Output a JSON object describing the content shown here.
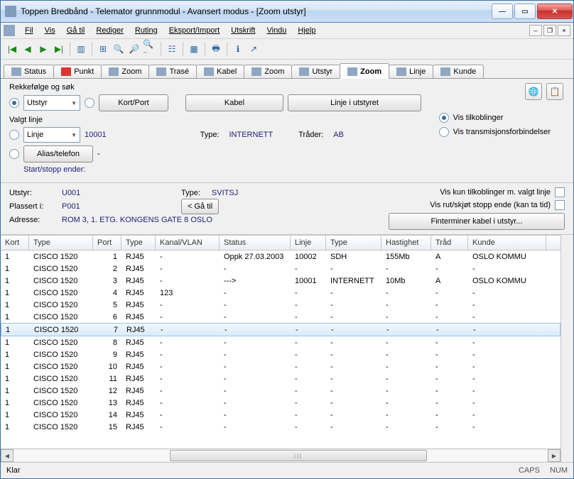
{
  "window": {
    "title": "Toppen Bredbånd - Telemator grunnmodul - Avansert modus - [Zoom utstyr]"
  },
  "menu": {
    "items": [
      "Fil",
      "Vis",
      "Gå til",
      "Rediger",
      "Ruting",
      "Eksport/Import",
      "Utskrift",
      "Vindu",
      "Hjelp"
    ]
  },
  "tabs": [
    {
      "label": "Status"
    },
    {
      "label": "Punkt"
    },
    {
      "label": "Zoom"
    },
    {
      "label": "Trasé"
    },
    {
      "label": "Kabel"
    },
    {
      "label": "Zoom"
    },
    {
      "label": "Utstyr"
    },
    {
      "label": "Zoom",
      "active": true
    },
    {
      "label": "Linje"
    },
    {
      "label": "Kunde"
    }
  ],
  "search": {
    "heading": "Rekkefølge og søk",
    "dropdown1": "Utstyr",
    "opt_kortport": "Kort/Port",
    "btn_kabel": "Kabel",
    "btn_linje": "Linje i utstyret"
  },
  "valgtlinje": {
    "heading": "Valgt linje",
    "dropdown": "Linje",
    "value": "10001",
    "type_label": "Type:",
    "type_value": "INTERNETT",
    "trader_label": "Tråder:",
    "trader_value": "AB",
    "alias_btn": "Alias/telefon",
    "alias_value": "-",
    "startstopp": "Start/stopp ender:"
  },
  "vis_opts": {
    "opt1": "Vis tilkoblinger",
    "opt2": "Vis transmisjonsforbindelser"
  },
  "mid": {
    "utstyr_label": "Utstyr:",
    "utstyr_value": "U001",
    "type_label": "Type:",
    "type_value": "SVITSJ",
    "plassert_label": "Plassert i:",
    "plassert_value": "P001",
    "gaatil": "< Gå til",
    "adresse_label": "Adresse:",
    "adresse_value": "ROM 3, 1. ETG. KONGENS GATE 8 OSLO",
    "chk1": "Vis kun tilkoblinger m. valgt linje",
    "chk2": "Vis rut/skjøt stopp ende (kan ta tid)",
    "btn_fint": "Finterminer kabel i utstyr..."
  },
  "table": {
    "headers": [
      "Kort",
      "Type",
      "Port",
      "Type",
      "Kanal/VLAN",
      "Status",
      "Linje",
      "Type",
      "Hastighet",
      "Tråd",
      "Kunde"
    ],
    "rows": [
      {
        "kort": "1",
        "type": "CISCO 1520",
        "port": "1",
        "ptype": "RJ45",
        "kanal": "-",
        "status": "Oppk 27.03.2003",
        "linje": "10002",
        "ltype": "SDH",
        "hast": "155Mb",
        "trad": "A",
        "kunde": "OSLO KOMMU"
      },
      {
        "kort": "1",
        "type": "CISCO 1520",
        "port": "2",
        "ptype": "RJ45",
        "kanal": "-",
        "status": "-",
        "linje": "-",
        "ltype": "-",
        "hast": "-",
        "trad": "-",
        "kunde": "-"
      },
      {
        "kort": "1",
        "type": "CISCO 1520",
        "port": "3",
        "ptype": "RJ45",
        "kanal": "-",
        "status": "--->",
        "linje": "10001",
        "ltype": "INTERNETT",
        "hast": "10Mb",
        "trad": "A",
        "kunde": "OSLO KOMMU"
      },
      {
        "kort": "1",
        "type": "CISCO 1520",
        "port": "4",
        "ptype": "RJ45",
        "kanal": "123",
        "status": "-",
        "linje": "-",
        "ltype": "-",
        "hast": "-",
        "trad": "-",
        "kunde": "-"
      },
      {
        "kort": "1",
        "type": "CISCO 1520",
        "port": "5",
        "ptype": "RJ45",
        "kanal": "-",
        "status": "-",
        "linje": "-",
        "ltype": "-",
        "hast": "-",
        "trad": "-",
        "kunde": "-"
      },
      {
        "kort": "1",
        "type": "CISCO 1520",
        "port": "6",
        "ptype": "RJ45",
        "kanal": "-",
        "status": "-",
        "linje": "-",
        "ltype": "-",
        "hast": "-",
        "trad": "-",
        "kunde": "-"
      },
      {
        "kort": "1",
        "type": "CISCO 1520",
        "port": "7",
        "ptype": "RJ45",
        "kanal": "-",
        "status": "-",
        "linje": "-",
        "ltype": "-",
        "hast": "-",
        "trad": "-",
        "kunde": "-",
        "selected": true
      },
      {
        "kort": "1",
        "type": "CISCO 1520",
        "port": "8",
        "ptype": "RJ45",
        "kanal": "-",
        "status": "-",
        "linje": "-",
        "ltype": "-",
        "hast": "-",
        "trad": "-",
        "kunde": "-"
      },
      {
        "kort": "1",
        "type": "CISCO 1520",
        "port": "9",
        "ptype": "RJ45",
        "kanal": "-",
        "status": "-",
        "linje": "-",
        "ltype": "-",
        "hast": "-",
        "trad": "-",
        "kunde": "-"
      },
      {
        "kort": "1",
        "type": "CISCO 1520",
        "port": "10",
        "ptype": "RJ45",
        "kanal": "-",
        "status": "-",
        "linje": "-",
        "ltype": "-",
        "hast": "-",
        "trad": "-",
        "kunde": "-"
      },
      {
        "kort": "1",
        "type": "CISCO 1520",
        "port": "11",
        "ptype": "RJ45",
        "kanal": "-",
        "status": "-",
        "linje": "-",
        "ltype": "-",
        "hast": "-",
        "trad": "-",
        "kunde": "-"
      },
      {
        "kort": "1",
        "type": "CISCO 1520",
        "port": "12",
        "ptype": "RJ45",
        "kanal": "-",
        "status": "-",
        "linje": "-",
        "ltype": "-",
        "hast": "-",
        "trad": "-",
        "kunde": "-"
      },
      {
        "kort": "1",
        "type": "CISCO 1520",
        "port": "13",
        "ptype": "RJ45",
        "kanal": "-",
        "status": "-",
        "linje": "-",
        "ltype": "-",
        "hast": "-",
        "trad": "-",
        "kunde": "-"
      },
      {
        "kort": "1",
        "type": "CISCO 1520",
        "port": "14",
        "ptype": "RJ45",
        "kanal": "-",
        "status": "-",
        "linje": "-",
        "ltype": "-",
        "hast": "-",
        "trad": "-",
        "kunde": "-"
      },
      {
        "kort": "1",
        "type": "CISCO 1520",
        "port": "15",
        "ptype": "RJ45",
        "kanal": "-",
        "status": "-",
        "linje": "-",
        "ltype": "-",
        "hast": "-",
        "trad": "-",
        "kunde": "-"
      }
    ]
  },
  "status": {
    "left": "Klar",
    "caps": "CAPS",
    "num": "NUM"
  }
}
